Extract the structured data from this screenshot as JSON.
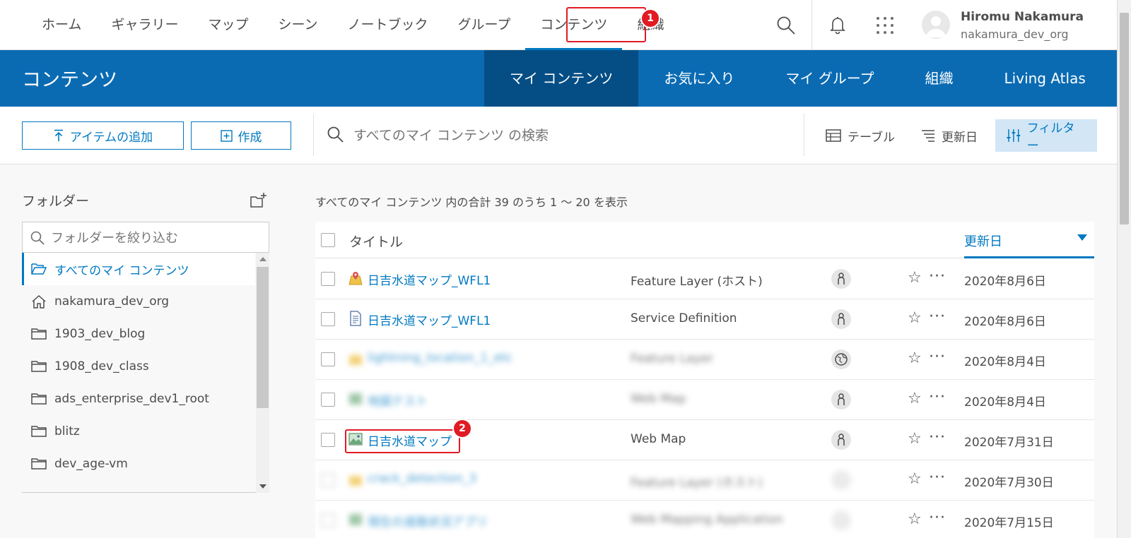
{
  "topnav": {
    "tabs": [
      "ホーム",
      "ギャラリー",
      "マップ",
      "シーン",
      "ノートブック",
      "グループ",
      "コンテンツ",
      "組織"
    ],
    "active_tab": "コンテンツ",
    "user": {
      "name": "Hiromu Nakamura",
      "org": "nakamura_dev_org"
    }
  },
  "header": {
    "title": "コンテンツ",
    "tabs": [
      "マイ コンテンツ",
      "お気に入り",
      "マイ グループ",
      "組織",
      "Living Atlas"
    ],
    "active_tab": "マイ コンテンツ"
  },
  "toolbar": {
    "add_item": "アイテムの追加",
    "create": "作成",
    "search_placeholder": "すべてのマイ コンテンツ の検索",
    "table_view": "テーブル",
    "sort": "更新日",
    "filter": "フィルター"
  },
  "folders": {
    "heading": "フォルダー",
    "filter_placeholder": "フォルダーを絞り込む",
    "items": [
      {
        "label": "すべてのマイ コンテンツ",
        "icon": "folder-open-icon",
        "selected": true
      },
      {
        "label": "nakamura_dev_org",
        "icon": "home-icon",
        "selected": false
      },
      {
        "label": "1903_dev_blog",
        "icon": "folder-icon",
        "selected": false
      },
      {
        "label": "1908_dev_class",
        "icon": "folder-icon",
        "selected": false
      },
      {
        "label": "ads_enterprise_dev1_root",
        "icon": "folder-icon",
        "selected": false
      },
      {
        "label": "blitz",
        "icon": "folder-icon",
        "selected": false
      },
      {
        "label": "dev_age-vm",
        "icon": "folder-icon",
        "selected": false
      }
    ]
  },
  "content": {
    "summary": "すべてのマイ コンテンツ 内の合計 39 のうち 1 ～ 20 を表示",
    "columns": {
      "title": "タイトル",
      "modified": "更新日"
    },
    "rows": [
      {
        "title": "日吉水道マップ_WFL1",
        "type": "Feature Layer (ホスト)",
        "date": "2020年8月6日",
        "icon": "feature-layer-icon",
        "share": "private-icon",
        "blurred": false
      },
      {
        "title": "日吉水道マップ_WFL1",
        "type": "Service Definition",
        "date": "2020年8月6日",
        "icon": "document-icon",
        "share": "private-icon",
        "blurred": false
      },
      {
        "title": "lightning_location_1_etc",
        "type": "Feature Layer",
        "date": "2020年8月4日",
        "icon": "feature-layer-icon",
        "share": "public-icon",
        "blurred": true
      },
      {
        "title": "地図テスト",
        "type": "Web Map",
        "date": "2020年8月4日",
        "icon": "web-map-icon",
        "share": "private-icon",
        "blurred": true
      },
      {
        "title": "日吉水道マップ",
        "type": "Web Map",
        "date": "2020年7月31日",
        "icon": "web-map-icon",
        "share": "private-icon",
        "blurred": false
      },
      {
        "title": "crack_detection_3",
        "type": "Feature Layer (ホスト)",
        "date": "2020年7月30日",
        "icon": "feature-layer-icon",
        "share": "private-icon",
        "blurred": true
      },
      {
        "title": "現在の道路状況アプリ",
        "type": "Web Mapping Application",
        "date": "2020年7月15日",
        "icon": "web-map-icon",
        "share": "private-icon",
        "blurred": true
      }
    ]
  },
  "annotations": {
    "badge1": "1",
    "badge2": "2",
    "color": "#e01b24"
  },
  "colors": {
    "accent": "#0079c1",
    "header": "#0a6bb3",
    "header_active": "#054e85"
  }
}
